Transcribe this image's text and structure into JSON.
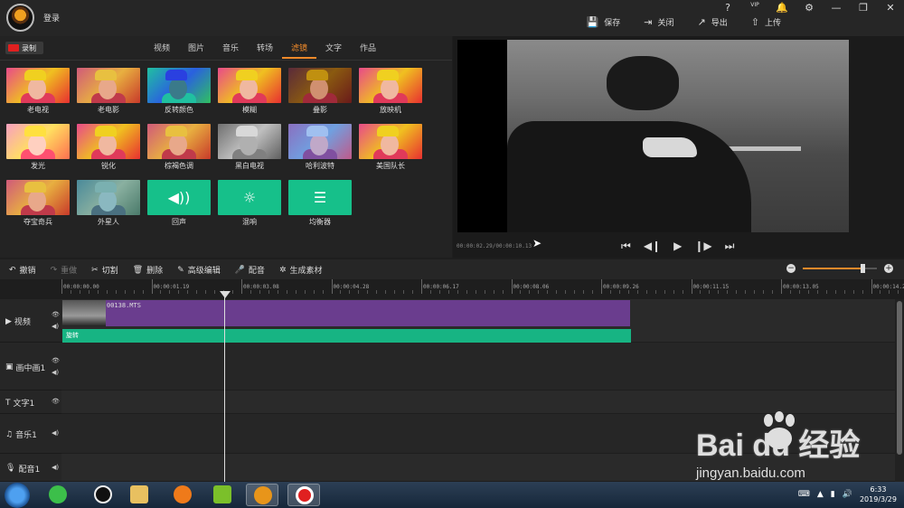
{
  "titlebar": {
    "login": "登录",
    "win_icons": [
      "?",
      "VIP",
      "🔔",
      "⚙",
      "—",
      "❐",
      "✕"
    ],
    "actions": [
      {
        "icon": "save-icon",
        "glyph": "💾",
        "label": "保存"
      },
      {
        "icon": "close-file-icon",
        "glyph": "⇥",
        "label": "关闭"
      },
      {
        "icon": "export-icon",
        "glyph": "↗",
        "label": "导出"
      },
      {
        "icon": "upload-icon",
        "glyph": "⇧",
        "label": "上传"
      }
    ]
  },
  "left": {
    "record_label": "录制",
    "tabs": [
      "视频",
      "图片",
      "音乐",
      "转场",
      "滤镜",
      "文字",
      "作品"
    ],
    "active_tab": "滤镜",
    "filters": [
      {
        "label": "老电视",
        "style": "warm"
      },
      {
        "label": "老电影",
        "style": "sepia"
      },
      {
        "label": "反转颜色",
        "style": "invert"
      },
      {
        "label": "模糊",
        "style": "warm"
      },
      {
        "label": "叠影",
        "style": "dark"
      },
      {
        "label": "放映机",
        "style": "warm"
      },
      {
        "label": "发光",
        "style": "bright"
      },
      {
        "label": "锐化",
        "style": "warm"
      },
      {
        "label": "棕褐色调",
        "style": "sepia"
      },
      {
        "label": "黑白电视",
        "style": "gray"
      },
      {
        "label": "哈利波特",
        "style": "cool"
      },
      {
        "label": "美国队长",
        "style": "warm"
      },
      {
        "label": "夺宝奇兵",
        "style": "sepia"
      },
      {
        "label": "外星人",
        "style": "alien"
      },
      {
        "label": "回声",
        "style": "effect",
        "icon": "echo-icon"
      },
      {
        "label": "混响",
        "style": "effect",
        "icon": "reverb-icon"
      },
      {
        "label": "均衡器",
        "style": "effect",
        "icon": "equalizer-icon"
      }
    ]
  },
  "preview": {
    "time": "00:00:02.29/00:00:10.13"
  },
  "toolbar": {
    "tools": [
      {
        "icon": "undo-icon",
        "glyph": "↶",
        "label": "撤销",
        "enabled": true
      },
      {
        "icon": "redo-icon",
        "glyph": "↷",
        "label": "重做",
        "enabled": false
      },
      {
        "icon": "cut-icon",
        "glyph": "✂",
        "label": "切割",
        "enabled": true
      },
      {
        "icon": "delete-icon",
        "glyph": "🗑",
        "label": "删除",
        "enabled": true
      },
      {
        "icon": "edit-icon",
        "glyph": "✎",
        "label": "高级编辑",
        "enabled": true
      },
      {
        "icon": "mic-icon",
        "glyph": "🎤",
        "label": "配音",
        "enabled": true
      },
      {
        "icon": "film-icon",
        "glyph": "✲",
        "label": "生成素材",
        "enabled": true
      }
    ],
    "zoom_level": 0.8
  },
  "timeline": {
    "ticks": [
      "00:00:00.00",
      "00:00:01.19",
      "00:00:03.08",
      "00:00:04.28",
      "00:00:06.17",
      "00:00:08.06",
      "00:00:09.26",
      "00:00:11.15",
      "00:00:13.05",
      "00:00:14.2"
    ],
    "tracks": [
      {
        "label": "视频",
        "glyph": "▶"
      },
      {
        "label": "画中画1",
        "glyph": "▣"
      },
      {
        "label": "文字1",
        "glyph": "T"
      },
      {
        "label": "音乐1",
        "glyph": "♫"
      },
      {
        "label": "配音1",
        "glyph": "🎙"
      }
    ],
    "clip_name": "00138.MTS",
    "filter_clip": "旋转"
  },
  "watermark": {
    "brand": "Bai  du 经验",
    "url": "jingyan.baidu.com"
  },
  "taskbar": {
    "time": "6:33",
    "date": "2019/3/29"
  }
}
